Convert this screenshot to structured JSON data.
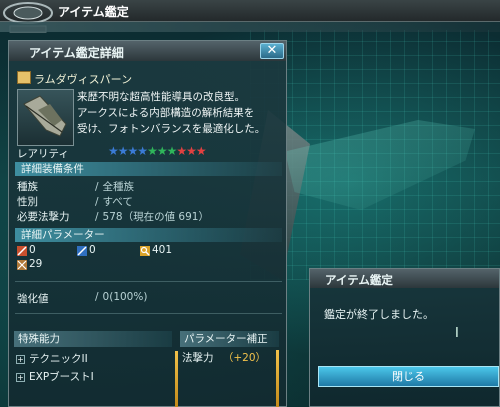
{
  "screen": {
    "title": "アイテム鑑定"
  },
  "panel": {
    "title": "アイテム鑑定詳細",
    "close_label": "✕",
    "item": {
      "icon": "rod-icon",
      "name": "ラムダヴィスパーン",
      "description": [
        "来歴不明な超高性能導具の改良型。",
        "アークスによる内部構造の解析結果を",
        "受け、フォトンバランスを最適化した。"
      ]
    },
    "rarity": {
      "label": "レアリティ",
      "stars": 10,
      "colors": [
        "#3a7bd5",
        "#3a7bd5",
        "#3a7bd5",
        "#3a7bd5",
        "#2fb55a",
        "#2fb55a",
        "#2fb55a",
        "#e24040",
        "#e24040",
        "#e24040"
      ]
    },
    "equip": {
      "section_label": "詳細装備条件",
      "rows": [
        {
          "key": "種族",
          "value": "全種族"
        },
        {
          "key": "性別",
          "value": "すべて"
        },
        {
          "key": "必要法撃力",
          "value": "578（現在の値 691）"
        }
      ]
    },
    "params": {
      "section_label": "詳細パラメーター",
      "values": [
        {
          "icon": "sword-icon",
          "value": "0"
        },
        {
          "icon": "gun-icon",
          "value": "0"
        },
        {
          "icon": "wand-icon",
          "value": "401"
        },
        {
          "icon": "element-icon",
          "value": "29"
        }
      ]
    },
    "grind": {
      "key": "強化値",
      "value": "0(100%)"
    },
    "abilities": {
      "label": "特殊能力",
      "items": [
        "テクニックII",
        "EXPブーストI"
      ]
    },
    "param_bonus": {
      "label": "パラメーター補正",
      "items": [
        {
          "key": "法撃力",
          "value": "+20"
        }
      ]
    }
  },
  "dialog": {
    "title": "アイテム鑑定",
    "message": "鑑定が終了しました。",
    "button_label": "閉じる"
  },
  "colors": {
    "accent_blue": "#4bc7ea",
    "bonus": "#f2c24a",
    "panel_bg": "#1c3a40"
  }
}
